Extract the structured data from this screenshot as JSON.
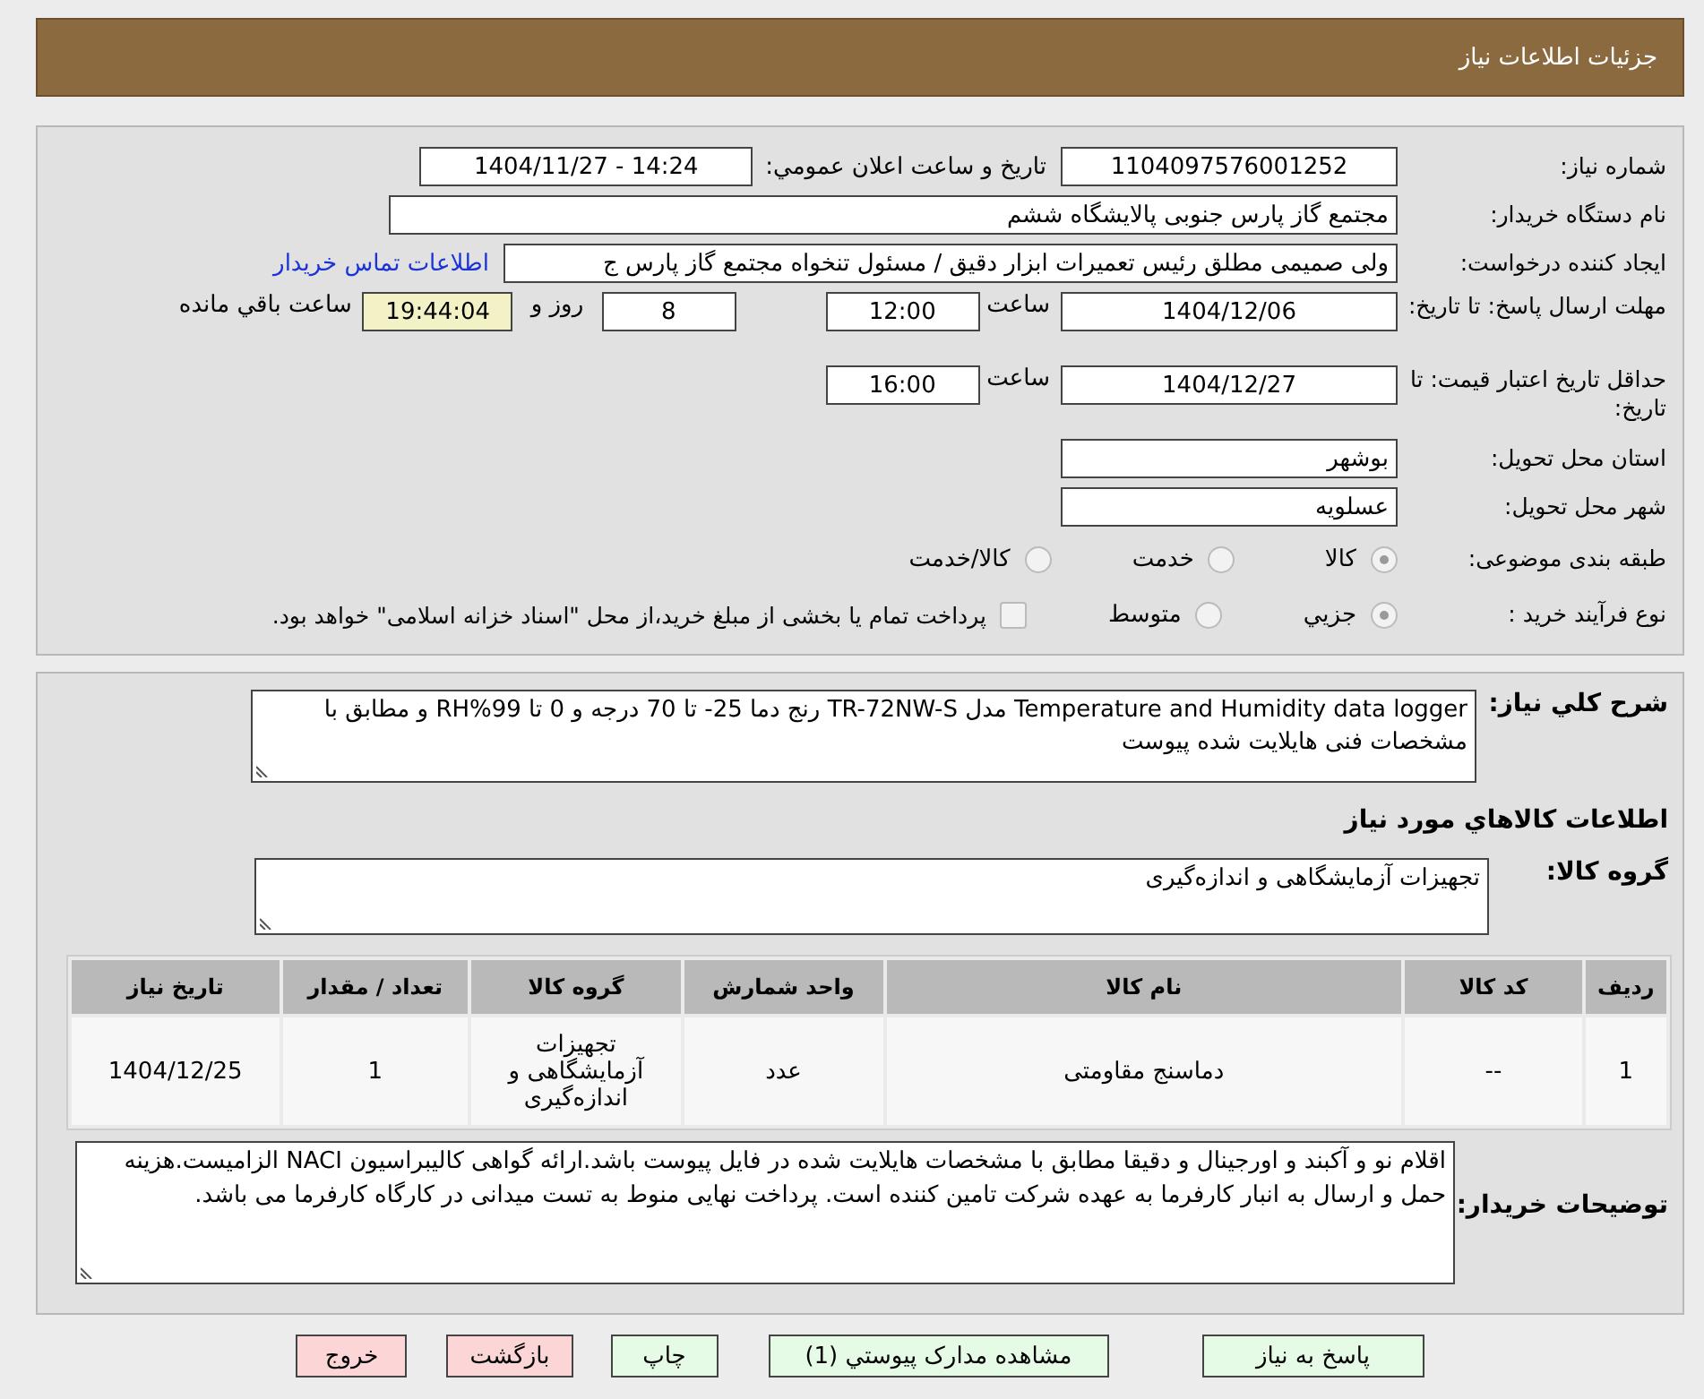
{
  "header": {
    "title": "جزئیات اطلاعات نیاز"
  },
  "need_number": {
    "label": "شماره نیاز:",
    "value": "1104097576001252"
  },
  "announce": {
    "label": "تاريخ و ساعت اعلان عمومي:",
    "value": "1404/11/27 - 14:24"
  },
  "buyer": {
    "label": "نام دستگاه خريدار:",
    "value": "مجتمع گاز پارس جنوبی  پالایشگاه ششم"
  },
  "requester": {
    "label": "ایجاد کننده درخواست:",
    "value": "ولی صمیمی مطلق رئیس تعمیرات ابزار دقیق / مسئول تنخواه مجتمع گاز پارس ج",
    "link": "اطلاعات تماس خریدار"
  },
  "response_deadline": {
    "label": "مهلت ارسال پاسخ: تا تاریخ:",
    "date": "1404/12/06",
    "time_label": "ساعت",
    "time": "12:00",
    "days": "8",
    "days_label": "روز و",
    "remaining": "19:44:04",
    "remaining_label": "ساعت باقي مانده"
  },
  "price_validity": {
    "label": "حداقل تاریخ اعتبار قیمت: تا تاریخ:",
    "date": "1404/12/27",
    "time_label": "ساعت",
    "time": "16:00"
  },
  "province": {
    "label": "استان محل تحویل:",
    "value": "بوشهر"
  },
  "city": {
    "label": "شهر محل تحویل:",
    "value": "عسلویه"
  },
  "category": {
    "label": "طبقه بندی موضوعی:",
    "options": [
      {
        "label": "کالا",
        "selected": true
      },
      {
        "label": "خدمت",
        "selected": false
      },
      {
        "label": "کالا/خدمت",
        "selected": false
      }
    ]
  },
  "process": {
    "label": "نوع فرآیند خرید :",
    "options": [
      {
        "label": "جزيي",
        "selected": true
      },
      {
        "label": "متوسط",
        "selected": false
      }
    ],
    "treasury": {
      "checked": false,
      "text": "پرداخت تمام یا بخشی از مبلغ خرید،از محل \"اسناد خزانه اسلامی\" خواهد بود."
    }
  },
  "description": {
    "label": "شرح کلي نياز:",
    "value": "Temperature and Humidity data logger مدل TR-72NW-S رنج دما 25- تا 70 درجه و 0 تا 99%RH و مطابق با مشخصات فنی هایلایت شده پیوست"
  },
  "goods_heading": "اطلاعات کالاهاي مورد نياز",
  "goods_group": {
    "label": "گروه کالا:",
    "value": "تجهیزات آزمایشگاهی و اندازه‌گیری"
  },
  "table": {
    "columns": [
      "رديف",
      "کد کالا",
      "نام کالا",
      "واحد شمارش",
      "گروه کالا",
      "تعداد / مقدار",
      "تاریخ نیاز"
    ],
    "rows": [
      [
        "1",
        "--",
        "دماسنج مقاومتی",
        "عدد",
        "تجهیزات آزمایشگاهی و اندازه‌گیری",
        "1",
        "1404/12/25"
      ]
    ]
  },
  "buyer_notes": {
    "label": "توضیحات خریدار:",
    "value": "اقلام نو و آکبند و اورجینال و دقیقا مطابق با مشخصات هایلایت شده در فایل پیوست باشد.ارائه گواهی کالیبراسیون NACI الزامیست.هزینه حمل و ارسال به انبار کارفرما به عهده شرکت تامین کننده است. پرداخت نهایی منوط به تست میدانی در کارگاه کارفرما می باشد."
  },
  "buttons": [
    {
      "label": "پاسخ به نیاز",
      "kind": "action"
    },
    {
      "label": "مشاهده مدارک پیوستي (1)",
      "kind": "action"
    },
    {
      "label": "چاپ",
      "kind": "action"
    },
    {
      "label": "بازگشت",
      "kind": "exit"
    },
    {
      "label": "خروج",
      "kind": "exit"
    }
  ]
}
